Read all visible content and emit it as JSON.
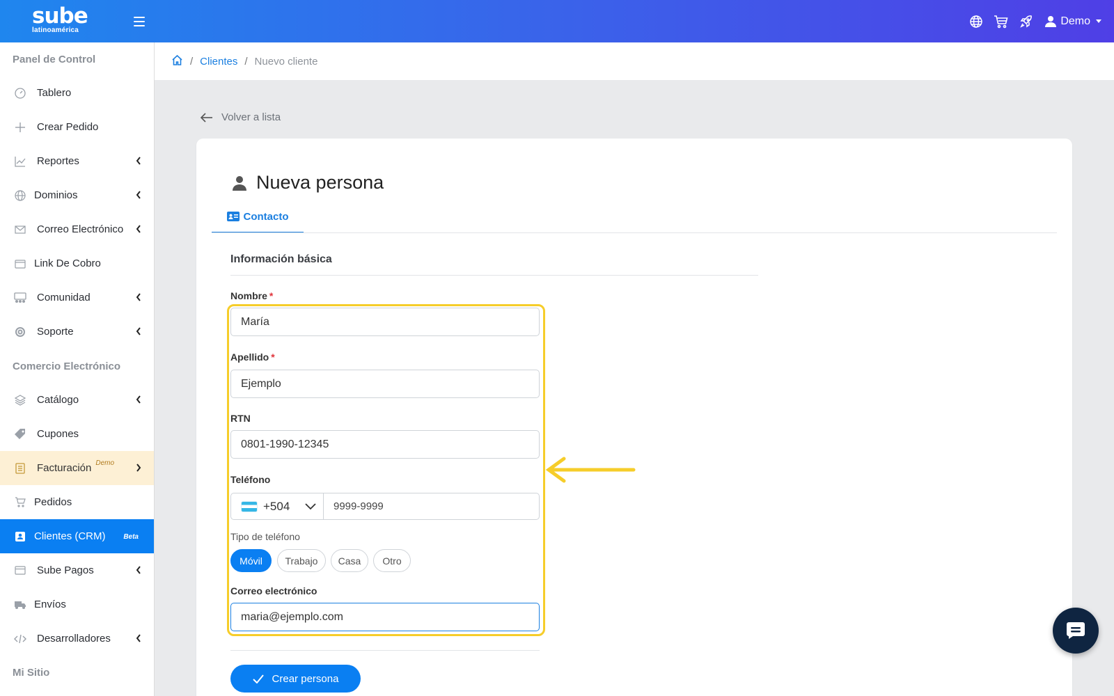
{
  "topbar": {
    "logo_main": "sube",
    "logo_sub": "latinoamérica",
    "user_label": "Demo"
  },
  "sidebar": {
    "section_1": "Panel de Control",
    "section_2": "Comercio Electrónico",
    "section_3": "Mi Sitio",
    "items": [
      {
        "label": "Tablero",
        "icon": "gauge-icon"
      },
      {
        "label": "Crear Pedido",
        "icon": "plus-icon"
      },
      {
        "label": "Reportes",
        "icon": "chart-line-icon"
      },
      {
        "label": "Dominios",
        "icon": "globe-icon"
      },
      {
        "label": "Correo Electrónico",
        "icon": "envelope-icon"
      },
      {
        "label": "Link De Cobro",
        "icon": "wallet-icon"
      },
      {
        "label": "Comunidad",
        "icon": "people-icon"
      },
      {
        "label": "Soporte",
        "icon": "lifebuoy-icon"
      },
      {
        "label": "Catálogo",
        "icon": "layers-icon"
      },
      {
        "label": "Cupones",
        "icon": "tag-icon"
      },
      {
        "label": "Facturación",
        "icon": "receipt-icon",
        "badge": "Demo"
      },
      {
        "label": "Pedidos",
        "icon": "cart-icon"
      },
      {
        "label": "Clientes (CRM)",
        "icon": "contact-card-icon",
        "badge": "Beta"
      },
      {
        "label": "Sube Pagos",
        "icon": "credit-card-icon"
      },
      {
        "label": "Envíos",
        "icon": "truck-icon"
      },
      {
        "label": "Desarrolladores",
        "icon": "code-icon"
      }
    ]
  },
  "breadcrumb": {
    "sep": "/",
    "clients": "Clientes",
    "current": "Nuevo cliente"
  },
  "back_label": "Volver a lista",
  "card": {
    "title": "Nueva persona",
    "tab_contact": "Contacto",
    "section": "Información básica"
  },
  "form": {
    "required_mark": "*",
    "nombre_label": "Nombre",
    "nombre_value": "María",
    "apellido_label": "Apellido",
    "apellido_value": "Ejemplo",
    "rtn_label": "RTN",
    "rtn_value": "0801-1990-12345",
    "telefono_label": "Teléfono",
    "country_code": "+504",
    "phone_placeholder": "9999-9999",
    "tipo_label": "Tipo de teléfono",
    "tipo_options": [
      "Móvil",
      "Trabajo",
      "Casa",
      "Otro"
    ],
    "tipo_selected": "Móvil",
    "correo_label": "Correo electrónico",
    "correo_value": "maria@ejemplo.com",
    "submit_label": "Crear persona"
  },
  "colors": {
    "primary": "#0a7ff2",
    "highlight": "#f6cd2a",
    "topbar_start": "#1f86ee",
    "topbar_end": "#4f3fe6"
  }
}
